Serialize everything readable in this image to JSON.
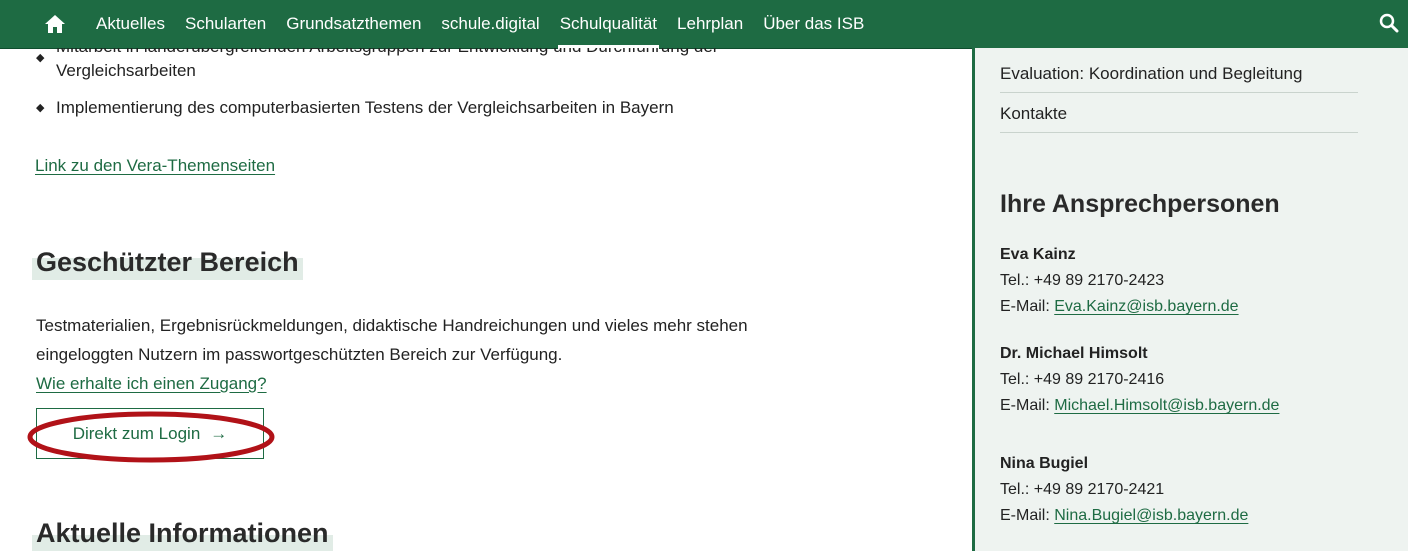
{
  "nav": {
    "items": [
      {
        "label": "Aktuelles"
      },
      {
        "label": "Schularten"
      },
      {
        "label": "Grundsatzthemen"
      },
      {
        "label": "schule.digital"
      },
      {
        "label": "Schulqualität"
      },
      {
        "label": "Lehrplan"
      },
      {
        "label": "Über das ISB"
      }
    ],
    "active": "Schulqualität",
    "home_icon": "home-icon",
    "search_icon": "search-icon"
  },
  "main": {
    "bullets": [
      {
        "text": "Mitarbeit in länderübergreifenden Arbeitsgruppen zur Entwicklung und Durchführung der",
        "text2": "Vergleichsarbeiten"
      },
      {
        "text": "Implementierung des computerbasierten Testens der Vergleichsarbeiten in Bayern"
      }
    ],
    "vera_link": "Link zu den Vera-Themenseiten",
    "protected_heading": "Geschützter Bereich",
    "protected_text_1": "Testmaterialien, Ergebnisrückmeldungen, didaktische Handreichungen und vieles mehr stehen",
    "protected_text_2": "eingeloggten Nutzern im passwortgeschützten Bereich zur Verfügung.",
    "access_link": "Wie erhalte ich einen Zugang?",
    "login_button": "Direkt zum Login",
    "login_arrow": "→",
    "news_heading": "Aktuelle Informationen"
  },
  "sidebar": {
    "links": [
      {
        "label": "Evaluation: Koordination und Begleitung"
      },
      {
        "label": "Kontakte"
      }
    ],
    "contacts_heading": "Ihre Ansprechpersonen",
    "contacts": [
      {
        "name": "Eva Kainz",
        "tel": "Tel.: +49 89 2170-2423",
        "email_prefix": "E-Mail: ",
        "email": "Eva.Kainz@isb.bayern.de"
      },
      {
        "name": "Dr. Michael Himsolt",
        "tel": "Tel.: +49 89 2170-2416",
        "email_prefix": "E-Mail: ",
        "email": "Michael.Himsolt@isb.bayern.de"
      },
      {
        "name": "Nina Bugiel",
        "tel": "Tel.: +49 89 2170-2421",
        "email_prefix": "E-Mail: ",
        "email": "Nina.Bugiel@isb.bayern.de"
      }
    ]
  },
  "colors": {
    "brand_green": "#1e6b43",
    "sidebar_bg": "#eef3f0",
    "highlight_red": "#b11218"
  }
}
